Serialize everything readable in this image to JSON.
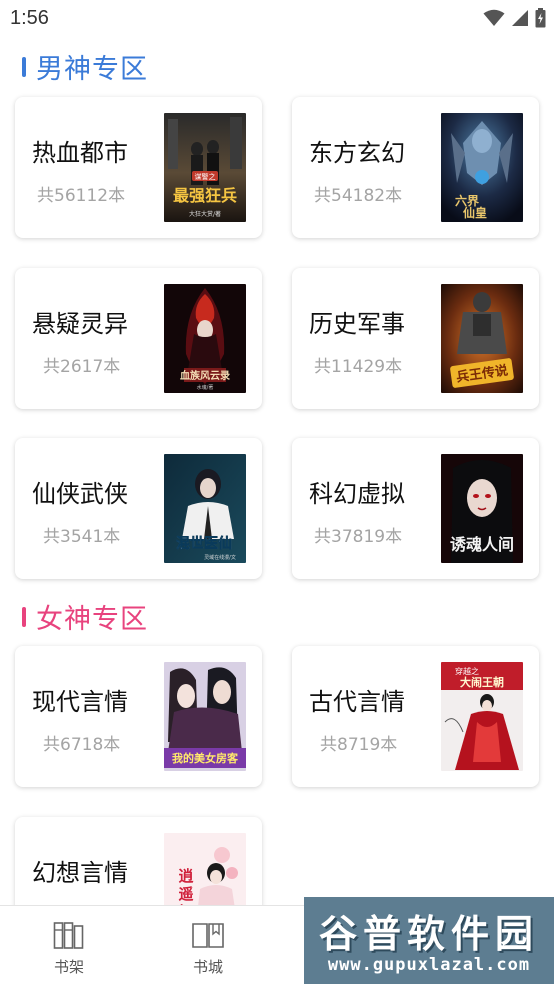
{
  "status_bar": {
    "time": "1:56"
  },
  "sections": {
    "male": {
      "title": "男神专区"
    },
    "female": {
      "title": "女神专区"
    }
  },
  "categories": [
    {
      "name": "热血都市",
      "count": "共56112本",
      "cover_title": "最强狂兵",
      "cover_byline": "大狂大赏/著"
    },
    {
      "name": "东方玄幻",
      "count": "共54182本",
      "cover_title": "六界仙皇",
      "cover_byline": ""
    },
    {
      "name": "悬疑灵异",
      "count": "共2617本",
      "cover_title": "血族风云录",
      "cover_byline": "水魂/著"
    },
    {
      "name": "历史军事",
      "count": "共11429本",
      "cover_title": "兵王传说",
      "cover_byline": ""
    },
    {
      "name": "仙侠武侠",
      "count": "共3541本",
      "cover_title": "混世医仙",
      "cover_byline": "灵域在线漫/文"
    },
    {
      "name": "科幻虚拟",
      "count": "共37819本",
      "cover_title": "诱魂人间",
      "cover_byline": ""
    },
    {
      "name": "现代言情",
      "count": "共6718本",
      "cover_title": "我的美女房客",
      "cover_byline": ""
    },
    {
      "name": "古代言情",
      "count": "共8719本",
      "cover_title": "大闹王朝",
      "cover_byline": "穿越之"
    },
    {
      "name": "幻想言情",
      "count": "",
      "cover_title": "逍遥妃",
      "cover_byline": ""
    }
  ],
  "tabbar": {
    "items": [
      {
        "label": "书架",
        "icon": "bookshelf-icon"
      },
      {
        "label": "书城",
        "icon": "open-book-icon"
      }
    ]
  },
  "watermark": {
    "title": "谷普软件园",
    "url": "www.gupuxlazal.com"
  },
  "colors": {
    "male_accent": "#3b7bd8",
    "female_accent": "#e8437e"
  }
}
